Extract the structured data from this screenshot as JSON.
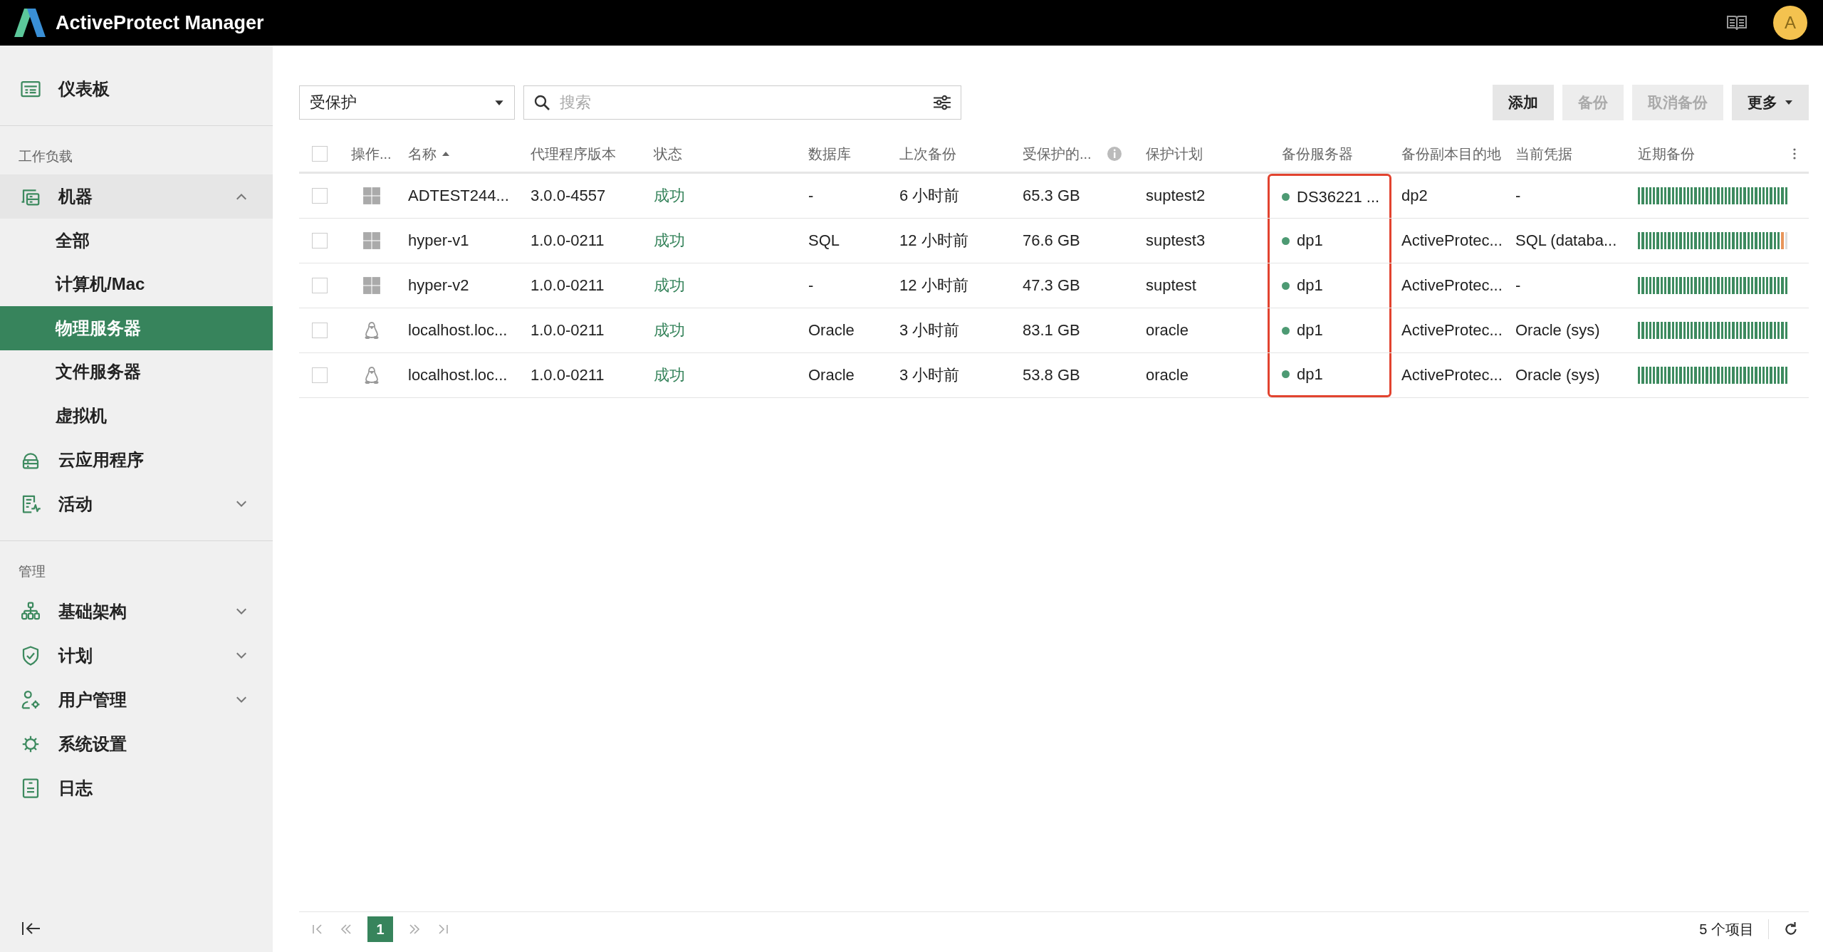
{
  "app": {
    "title": "ActiveProtect Manager",
    "avatar": "A"
  },
  "sidebar": {
    "items": [
      {
        "kind": "item",
        "label": "仪表板",
        "selected": false
      },
      {
        "kind": "divider"
      },
      {
        "kind": "section",
        "label": "工作负载"
      },
      {
        "kind": "item",
        "label": "机器",
        "selected": false,
        "expanded": true,
        "children": [
          {
            "label": "全部",
            "selected": false
          },
          {
            "label": "计算机/Mac",
            "selected": false
          },
          {
            "label": "物理服务器",
            "selected": true
          },
          {
            "label": "文件服务器",
            "selected": false
          },
          {
            "label": "虚拟机",
            "selected": false
          }
        ]
      },
      {
        "kind": "item",
        "label": "云应用程序",
        "selected": false
      },
      {
        "kind": "item",
        "label": "活动",
        "selected": false,
        "expanded": false
      },
      {
        "kind": "divider"
      },
      {
        "kind": "section",
        "label": "管理"
      },
      {
        "kind": "item",
        "label": "基础架构",
        "selected": false,
        "expanded": false
      },
      {
        "kind": "item",
        "label": "计划",
        "selected": false,
        "expanded": false
      },
      {
        "kind": "item",
        "label": "用户管理",
        "selected": false,
        "expanded": false
      },
      {
        "kind": "item",
        "label": "系统设置",
        "selected": false
      },
      {
        "kind": "item",
        "label": "日志",
        "selected": false
      }
    ]
  },
  "toolbar": {
    "filter": "受保护",
    "search": {
      "placeholder": "搜索"
    },
    "buttons": [
      {
        "label": "添加",
        "disabled": false,
        "dropdown": false
      },
      {
        "label": "备份",
        "disabled": true,
        "dropdown": false
      },
      {
        "label": "取消备份",
        "disabled": true,
        "dropdown": false
      },
      {
        "label": "更多",
        "disabled": false,
        "dropdown": true
      }
    ]
  },
  "table": {
    "all_checked": false,
    "columns": [
      {
        "label": "操作..."
      },
      {
        "label": "名称",
        "sorted": true
      },
      {
        "label": "代理程序版本"
      },
      {
        "label": "状态"
      },
      {
        "label": "数据库"
      },
      {
        "label": "上次备份"
      },
      {
        "label": "受保护的...",
        "info": true
      },
      {
        "label": "保护计划"
      },
      {
        "label": "备份服务器",
        "highlighted": true
      },
      {
        "label": "备份副本目的地"
      },
      {
        "label": "当前凭据"
      },
      {
        "label": "近期备份"
      }
    ],
    "rows": [
      {
        "checked": false,
        "kind": "windows",
        "name": "ADTEST244...",
        "agent": "3.0.0-4557",
        "status": "成功",
        "database": "-",
        "last": "6 小时前",
        "protected": "65.3 GB",
        "plan": "suptest2",
        "server": "DS36221 ...",
        "dest": "dp2",
        "cred": "-",
        "recent": [
          {
            "color": "#3d8a5f"
          },
          {
            "color": "#3d8a5f"
          },
          {
            "color": "#3d8a5f"
          },
          {
            "color": "#3d8a5f"
          },
          {
            "color": "#3d8a5f"
          },
          {
            "color": "#3d8a5f"
          },
          {
            "color": "#3d8a5f"
          },
          {
            "color": "#3d8a5f"
          },
          {
            "color": "#3d8a5f"
          },
          {
            "color": "#3d8a5f"
          },
          {
            "color": "#3d8a5f"
          },
          {
            "color": "#3d8a5f"
          },
          {
            "color": "#3d8a5f"
          },
          {
            "color": "#3d8a5f"
          },
          {
            "color": "#3d8a5f"
          },
          {
            "color": "#3d8a5f"
          },
          {
            "color": "#3d8a5f"
          },
          {
            "color": "#3d8a5f"
          },
          {
            "color": "#3d8a5f"
          },
          {
            "color": "#3d8a5f"
          },
          {
            "color": "#3d8a5f"
          },
          {
            "color": "#3d8a5f"
          },
          {
            "color": "#3d8a5f"
          },
          {
            "color": "#3d8a5f"
          },
          {
            "color": "#3d8a5f"
          },
          {
            "color": "#3d8a5f"
          },
          {
            "color": "#3d8a5f"
          },
          {
            "color": "#3d8a5f"
          },
          {
            "color": "#3d8a5f"
          },
          {
            "color": "#3d8a5f"
          },
          {
            "color": "#3d8a5f"
          },
          {
            "color": "#3d8a5f"
          },
          {
            "color": "#3d8a5f"
          },
          {
            "color": "#3d8a5f"
          },
          {
            "color": "#3d8a5f"
          },
          {
            "color": "#3d8a5f"
          },
          {
            "color": "#3d8a5f"
          },
          {
            "color": "#3d8a5f"
          },
          {
            "color": "#3d8a5f"
          },
          {
            "color": "#3d8a5f"
          }
        ]
      },
      {
        "checked": false,
        "kind": "windows",
        "name": "hyper-v1",
        "agent": "1.0.0-0211",
        "status": "成功",
        "database": "SQL",
        "last": "12 小时前",
        "protected": "76.6 GB",
        "plan": "suptest3",
        "server": "dp1",
        "dest": "ActiveProtec...",
        "cred": "SQL (databa...",
        "recent": [
          {
            "color": "#3d8a5f"
          },
          {
            "color": "#3d8a5f"
          },
          {
            "color": "#3d8a5f"
          },
          {
            "color": "#3d8a5f"
          },
          {
            "color": "#3d8a5f"
          },
          {
            "color": "#3d8a5f"
          },
          {
            "color": "#3d8a5f"
          },
          {
            "color": "#3d8a5f"
          },
          {
            "color": "#3d8a5f"
          },
          {
            "color": "#3d8a5f"
          },
          {
            "color": "#3d8a5f"
          },
          {
            "color": "#3d8a5f"
          },
          {
            "color": "#3d8a5f"
          },
          {
            "color": "#3d8a5f"
          },
          {
            "color": "#3d8a5f"
          },
          {
            "color": "#3d8a5f"
          },
          {
            "color": "#3d8a5f"
          },
          {
            "color": "#3d8a5f"
          },
          {
            "color": "#3d8a5f"
          },
          {
            "color": "#3d8a5f"
          },
          {
            "color": "#3d8a5f"
          },
          {
            "color": "#3d8a5f"
          },
          {
            "color": "#3d8a5f"
          },
          {
            "color": "#3d8a5f"
          },
          {
            "color": "#3d8a5f"
          },
          {
            "color": "#3d8a5f"
          },
          {
            "color": "#3d8a5f"
          },
          {
            "color": "#3d8a5f"
          },
          {
            "color": "#3d8a5f"
          },
          {
            "color": "#3d8a5f"
          },
          {
            "color": "#3d8a5f"
          },
          {
            "color": "#3d8a5f"
          },
          {
            "color": "#3d8a5f"
          },
          {
            "color": "#3d8a5f"
          },
          {
            "color": "#3d8a5f"
          },
          {
            "color": "#3d8a5f"
          },
          {
            "color": "#3d8a5f"
          },
          {
            "color": "#3d8a5f"
          },
          {
            "color": "#e8955a"
          },
          {
            "color": "#dddddd"
          }
        ]
      },
      {
        "checked": false,
        "kind": "windows",
        "name": "hyper-v2",
        "agent": "1.0.0-0211",
        "status": "成功",
        "database": "-",
        "last": "12 小时前",
        "protected": "47.3 GB",
        "plan": "suptest",
        "server": "dp1",
        "dest": "ActiveProtec...",
        "cred": "-",
        "recent": [
          {
            "color": "#3d8a5f"
          },
          {
            "color": "#3d8a5f"
          },
          {
            "color": "#3d8a5f"
          },
          {
            "color": "#3d8a5f"
          },
          {
            "color": "#3d8a5f"
          },
          {
            "color": "#3d8a5f"
          },
          {
            "color": "#3d8a5f"
          },
          {
            "color": "#3d8a5f"
          },
          {
            "color": "#3d8a5f"
          },
          {
            "color": "#3d8a5f"
          },
          {
            "color": "#3d8a5f"
          },
          {
            "color": "#3d8a5f"
          },
          {
            "color": "#3d8a5f"
          },
          {
            "color": "#3d8a5f"
          },
          {
            "color": "#3d8a5f"
          },
          {
            "color": "#3d8a5f"
          },
          {
            "color": "#3d8a5f"
          },
          {
            "color": "#3d8a5f"
          },
          {
            "color": "#3d8a5f"
          },
          {
            "color": "#3d8a5f"
          },
          {
            "color": "#3d8a5f"
          },
          {
            "color": "#3d8a5f"
          },
          {
            "color": "#3d8a5f"
          },
          {
            "color": "#3d8a5f"
          },
          {
            "color": "#3d8a5f"
          },
          {
            "color": "#3d8a5f"
          },
          {
            "color": "#3d8a5f"
          },
          {
            "color": "#3d8a5f"
          },
          {
            "color": "#3d8a5f"
          },
          {
            "color": "#3d8a5f"
          },
          {
            "color": "#3d8a5f"
          },
          {
            "color": "#3d8a5f"
          },
          {
            "color": "#3d8a5f"
          },
          {
            "color": "#3d8a5f"
          },
          {
            "color": "#3d8a5f"
          },
          {
            "color": "#3d8a5f"
          },
          {
            "color": "#3d8a5f"
          },
          {
            "color": "#3d8a5f"
          },
          {
            "color": "#3d8a5f"
          },
          {
            "color": "#3d8a5f"
          }
        ]
      },
      {
        "checked": false,
        "kind": "linux",
        "name": "localhost.loc...",
        "agent": "1.0.0-0211",
        "status": "成功",
        "database": "Oracle",
        "last": "3 小时前",
        "protected": "83.1 GB",
        "plan": "oracle",
        "server": "dp1",
        "dest": "ActiveProtec...",
        "cred": "Oracle (sys)",
        "recent": [
          {
            "color": "#3d8a5f"
          },
          {
            "color": "#3d8a5f"
          },
          {
            "color": "#3d8a5f"
          },
          {
            "color": "#3d8a5f"
          },
          {
            "color": "#3d8a5f"
          },
          {
            "color": "#3d8a5f"
          },
          {
            "color": "#3d8a5f"
          },
          {
            "color": "#3d8a5f"
          },
          {
            "color": "#3d8a5f"
          },
          {
            "color": "#3d8a5f"
          },
          {
            "color": "#3d8a5f"
          },
          {
            "color": "#3d8a5f"
          },
          {
            "color": "#3d8a5f"
          },
          {
            "color": "#3d8a5f"
          },
          {
            "color": "#3d8a5f"
          },
          {
            "color": "#3d8a5f"
          },
          {
            "color": "#3d8a5f"
          },
          {
            "color": "#3d8a5f"
          },
          {
            "color": "#3d8a5f"
          },
          {
            "color": "#3d8a5f"
          },
          {
            "color": "#3d8a5f"
          },
          {
            "color": "#3d8a5f"
          },
          {
            "color": "#3d8a5f"
          },
          {
            "color": "#3d8a5f"
          },
          {
            "color": "#3d8a5f"
          },
          {
            "color": "#3d8a5f"
          },
          {
            "color": "#3d8a5f"
          },
          {
            "color": "#3d8a5f"
          },
          {
            "color": "#3d8a5f"
          },
          {
            "color": "#3d8a5f"
          },
          {
            "color": "#3d8a5f"
          },
          {
            "color": "#3d8a5f"
          },
          {
            "color": "#3d8a5f"
          },
          {
            "color": "#3d8a5f"
          },
          {
            "color": "#3d8a5f"
          },
          {
            "color": "#3d8a5f"
          },
          {
            "color": "#3d8a5f"
          },
          {
            "color": "#3d8a5f"
          },
          {
            "color": "#3d8a5f"
          },
          {
            "color": "#3d8a5f"
          }
        ]
      },
      {
        "checked": false,
        "kind": "linux",
        "name": "localhost.loc...",
        "agent": "1.0.0-0211",
        "status": "成功",
        "database": "Oracle",
        "last": "3 小时前",
        "protected": "53.8 GB",
        "plan": "oracle",
        "server": "dp1",
        "dest": "ActiveProtec...",
        "cred": "Oracle (sys)",
        "recent": [
          {
            "color": "#3d8a5f"
          },
          {
            "color": "#3d8a5f"
          },
          {
            "color": "#3d8a5f"
          },
          {
            "color": "#3d8a5f"
          },
          {
            "color": "#3d8a5f"
          },
          {
            "color": "#3d8a5f"
          },
          {
            "color": "#3d8a5f"
          },
          {
            "color": "#3d8a5f"
          },
          {
            "color": "#3d8a5f"
          },
          {
            "color": "#3d8a5f"
          },
          {
            "color": "#3d8a5f"
          },
          {
            "color": "#3d8a5f"
          },
          {
            "color": "#3d8a5f"
          },
          {
            "color": "#3d8a5f"
          },
          {
            "color": "#3d8a5f"
          },
          {
            "color": "#3d8a5f"
          },
          {
            "color": "#3d8a5f"
          },
          {
            "color": "#3d8a5f"
          },
          {
            "color": "#3d8a5f"
          },
          {
            "color": "#3d8a5f"
          },
          {
            "color": "#3d8a5f"
          },
          {
            "color": "#3d8a5f"
          },
          {
            "color": "#3d8a5f"
          },
          {
            "color": "#3d8a5f"
          },
          {
            "color": "#3d8a5f"
          },
          {
            "color": "#3d8a5f"
          },
          {
            "color": "#3d8a5f"
          },
          {
            "color": "#3d8a5f"
          },
          {
            "color": "#3d8a5f"
          },
          {
            "color": "#3d8a5f"
          },
          {
            "color": "#3d8a5f"
          },
          {
            "color": "#3d8a5f"
          },
          {
            "color": "#3d8a5f"
          },
          {
            "color": "#3d8a5f"
          },
          {
            "color": "#3d8a5f"
          },
          {
            "color": "#3d8a5f"
          },
          {
            "color": "#3d8a5f"
          },
          {
            "color": "#3d8a5f"
          },
          {
            "color": "#3d8a5f"
          },
          {
            "color": "#3d8a5f"
          }
        ]
      }
    ]
  },
  "pagination": {
    "pages": [
      {
        "label": "1",
        "selected": true
      }
    ],
    "count": "5 个项目"
  }
}
